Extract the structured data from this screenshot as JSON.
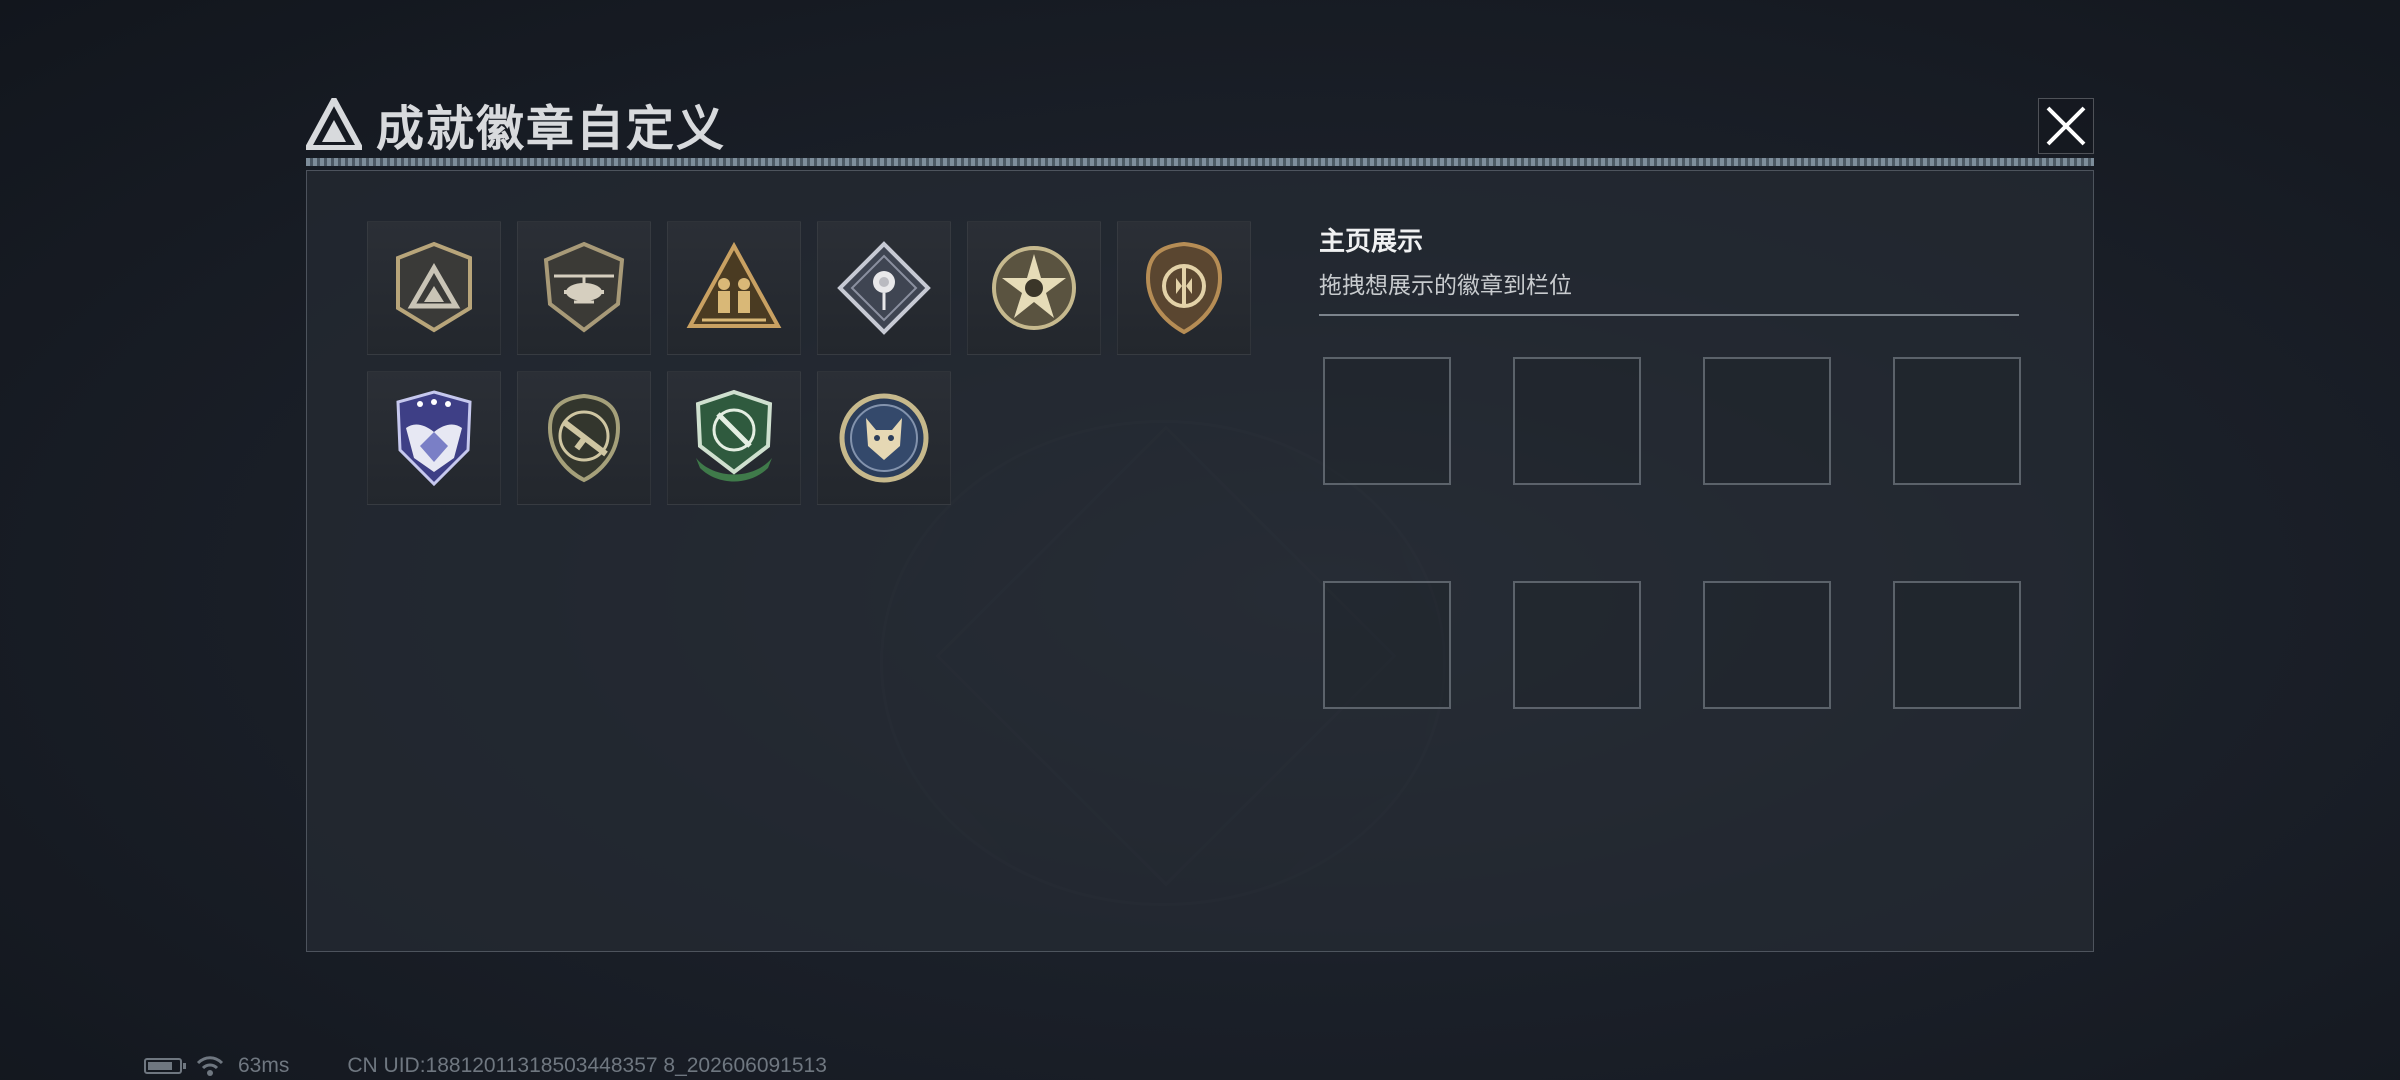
{
  "window": {
    "title": "成就徽章自定义"
  },
  "badges": [
    {
      "icon": "triangle-logo-shield-badge-icon"
    },
    {
      "icon": "helicopter-shield-badge-icon"
    },
    {
      "icon": "soldiers-triangle-badge-icon"
    },
    {
      "icon": "rose-diamond-badge-icon"
    },
    {
      "icon": "star-medallion-badge-icon"
    },
    {
      "icon": "round-shield-badge-icon"
    },
    {
      "icon": "winged-diamond-badge-icon"
    },
    {
      "icon": "rifle-shield-badge-icon"
    },
    {
      "icon": "green-knife-shield-badge-icon"
    },
    {
      "icon": "wolf-medallion-badge-icon"
    }
  ],
  "display": {
    "title": "主页展示",
    "subtitle": "拖拽想展示的徽章到栏位",
    "slot_count": 8
  },
  "status": {
    "battery_level": 0.8,
    "ping": "63ms",
    "uid": "CN UID:18812011318503448357 8_202606091513"
  },
  "colors": {
    "gold": "#b8a57a",
    "accent_line": "#9fb3c2",
    "panel": "#262b33"
  }
}
